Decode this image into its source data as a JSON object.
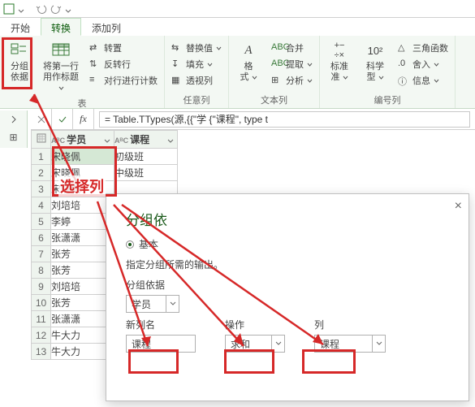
{
  "tabs": {
    "home": "开始",
    "transform": "转换",
    "addcol": "添加列"
  },
  "ribbon": {
    "groupby": {
      "l1": "分组",
      "l2": "依据"
    },
    "firstrow": {
      "l1": "将第一行",
      "l2": "用作标题"
    },
    "transpose": "转置",
    "reverse": "反转行",
    "countrows": "对行进行计数",
    "g1label": "表",
    "replace": "替换值",
    "fill": "填充",
    "pivot": "透视列",
    "g2label": "任意列",
    "format": {
      "l1": "格",
      "l2": "式"
    },
    "merge": "合并",
    "extract": "提取",
    "parse": "分析",
    "g3label": "文本列",
    "std": {
      "l1": "标准",
      "sub": "准"
    },
    "sci": {
      "l1": "科学",
      "l2": "型"
    },
    "trig": "三角函数",
    "round": "舍入",
    "info": "信息",
    "tenx": "10²",
    "g4label": "编号列"
  },
  "fx_label": "fx",
  "formula": "= Table.TTypes(源,{{\"学 {\"课程\", type t",
  "columns": {
    "c1": "学员",
    "c2": "课程",
    "type": "AᴮC"
  },
  "rows": [
    {
      "n": "1",
      "c1": "宋晓佩",
      "c2": "初级班"
    },
    {
      "n": "2",
      "c1": "宋晓佩",
      "c2": "中级班"
    },
    {
      "n": "3",
      "c1": "宋晓佩",
      "c2": ""
    },
    {
      "n": "4",
      "c1": "刘培培",
      "c2": ""
    },
    {
      "n": "5",
      "c1": "李婷",
      "c2": ""
    },
    {
      "n": "6",
      "c1": "张潇潇",
      "c2": ""
    },
    {
      "n": "7",
      "c1": "张芳",
      "c2": ""
    },
    {
      "n": "8",
      "c1": "张芳",
      "c2": ""
    },
    {
      "n": "9",
      "c1": "刘培培",
      "c2": ""
    },
    {
      "n": "10",
      "c1": "张芳",
      "c2": ""
    },
    {
      "n": "11",
      "c1": "张潇潇",
      "c2": ""
    },
    {
      "n": "12",
      "c1": "牛大力",
      "c2": ""
    },
    {
      "n": "13",
      "c1": "牛大力",
      "c2": ""
    }
  ],
  "dialog": {
    "title": "分组依",
    "basic": "基本",
    "desc": "指定分组所需的输出。",
    "group_by_label": "分组依据",
    "group_by_value": "学员",
    "newcol_label": "新列名",
    "newcol_value": "课程",
    "op_label": "操作",
    "op_value": "求和",
    "col_label": "列",
    "col_value": "课程"
  },
  "annot": {
    "pickcol": "选择列"
  }
}
